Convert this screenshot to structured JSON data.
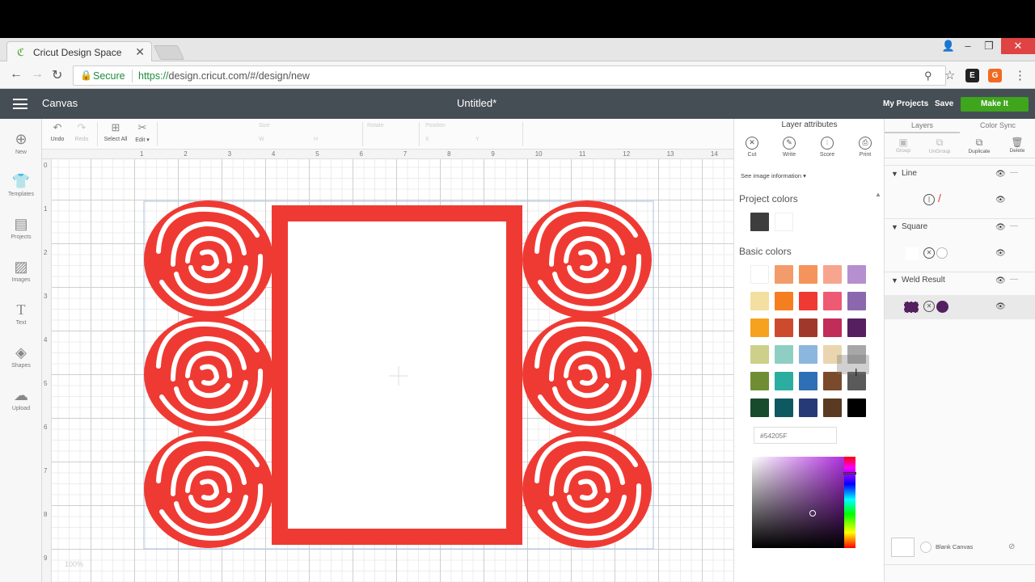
{
  "browser": {
    "tab_title": "Cricut Design Space",
    "tab_favicon": "cricut-c-icon",
    "secure_label": "Secure",
    "url_scheme": "https://",
    "url_rest": "design.cricut.com/#/design/new"
  },
  "header": {
    "section": "Canvas",
    "document_title": "Untitled*",
    "my_projects": "My Projects",
    "save": "Save",
    "make_it": "Make It",
    "make_it_color": "#3fa51c",
    "bar_color": "#464e55"
  },
  "left_sidebar": {
    "items": [
      {
        "label": "New",
        "icon": "plus-circle-icon"
      },
      {
        "label": "Templates",
        "icon": "shirt-icon"
      },
      {
        "label": "Projects",
        "icon": "projects-icon"
      },
      {
        "label": "Images",
        "icon": "image-icon"
      },
      {
        "label": "Text",
        "icon": "text-icon"
      },
      {
        "label": "Shapes",
        "icon": "shapes-icon"
      },
      {
        "label": "Upload",
        "icon": "cloud-upload-icon"
      }
    ]
  },
  "toolbar": {
    "undo": "Undo",
    "redo": "Redo",
    "select_all": "Select All",
    "edit": "Edit ▾",
    "size_label": "Size",
    "rotate_label": "Rotate",
    "position_label": "Position",
    "x_label": "X",
    "y_label": "Y",
    "w_label": "W",
    "h_label": "H"
  },
  "canvas": {
    "ruler_top": [
      "1",
      "2",
      "3",
      "4",
      "5",
      "6",
      "7",
      "8",
      "9",
      "10",
      "11",
      "12",
      "13",
      "14",
      "15"
    ],
    "ruler_left": [
      "0",
      "1",
      "2",
      "3",
      "4",
      "5",
      "6",
      "7",
      "8",
      "9"
    ],
    "design_color": "#ef3a33",
    "zoom": "100%"
  },
  "attributes": {
    "title": "Layer attributes",
    "tools": [
      {
        "label": "Cut",
        "icon": "cut-icon"
      },
      {
        "label": "Write",
        "icon": "pen-icon"
      },
      {
        "label": "Score",
        "icon": "score-icon"
      },
      {
        "label": "Print",
        "icon": "print-icon"
      }
    ],
    "see_info": "See image information ▾",
    "project_colors_heading": "Project colors",
    "project_colors": [
      "#3d3d3d",
      "#ffffff"
    ],
    "basic_colors_heading": "Basic colors",
    "basic_colors": [
      [
        "#ffffff",
        "#f39c6b",
        "#f4935b",
        "#f7a58f",
        "#b58fcf"
      ],
      [
        "#f3dfa0",
        "#f57f20",
        "#ef3a33",
        "#ee5a74",
        "#8b67ad"
      ],
      [
        "#f6a21e",
        "#cc4b2f",
        "#a1382c",
        "#c12c5a",
        "#56205f"
      ],
      [
        "#cdd08a",
        "#8fcfc3",
        "#8db6df",
        "#e9d6b0",
        "#a7a7a7"
      ],
      [
        "#6f8e34",
        "#2bada0",
        "#2f6fb5",
        "#7a4a2b",
        "#5a5a5a"
      ],
      [
        "#184a2c",
        "#0e5961",
        "#273a78",
        "#5a3a22",
        "#000000"
      ]
    ],
    "hex_value": "#54205F",
    "tooltip_text": "Color Name"
  },
  "layers_panel": {
    "tab_layers": "Layers",
    "tab_color_sync": "Color Sync",
    "actions": [
      {
        "label": "Group",
        "icon": "group-icon",
        "enabled": false
      },
      {
        "label": "UnGroup",
        "icon": "ungroup-icon",
        "enabled": false
      },
      {
        "label": "Duplicate",
        "icon": "duplicate-icon",
        "enabled": true
      },
      {
        "label": "Delete",
        "icon": "trash-icon",
        "enabled": true
      }
    ],
    "groups": [
      {
        "name": "Line"
      },
      {
        "name": "Square"
      },
      {
        "name": "Weld Result"
      }
    ],
    "blank_canvas": "Blank Canvas"
  }
}
